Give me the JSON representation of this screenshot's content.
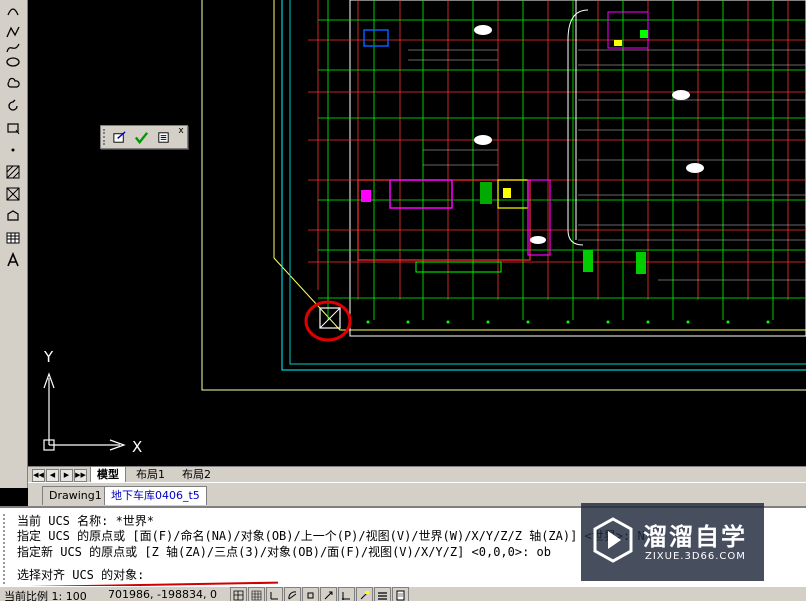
{
  "layout_tabs": {
    "nav_first": "◀◀",
    "nav_prev": "◀",
    "nav_next": "▶",
    "nav_last": "▶▶",
    "items": [
      "模型",
      "布局1",
      "布局2"
    ]
  },
  "document_tabs": [
    "Drawing1",
    "地下车库0406_t5"
  ],
  "command_line": {
    "line1": "当前 UCS 名称:  *世界*",
    "line2": "指定 UCS 的原点或 [面(F)/命名(NA)/对象(OB)/上一个(P)/视图(V)/世界(W)/X/Y/Z/Z 轴(ZA)] <世界>: N",
    "line3": "指定新 UCS 的原点或 [Z 轴(ZA)/三点(3)/对象(OB)/面(F)/视图(V)/X/Y/Z] <0,0,0>: ob",
    "prompt": "选择对齐 UCS 的对象:"
  },
  "status_bar": {
    "scale": "当前比例 1: 100",
    "coords": "701986,  -198834, 0"
  },
  "ucs_icon": {
    "x_label": "X",
    "y_label": "Y"
  },
  "float_toolbar": {
    "close": "x"
  },
  "watermark": {
    "title": "溜溜自学",
    "url": "ZIXUE.3D66.COM"
  },
  "icons": {
    "left_toolbar": [
      "arc-icon",
      "polyline-icon",
      "spline-icon",
      "ellipse-icon",
      "revision-cloud-icon",
      "rotate-icon",
      "block-icon",
      "point-icon",
      "hatch-icon",
      "gradient-icon",
      "region-icon",
      "table-icon",
      "text-icon"
    ]
  },
  "colors": {
    "canvas_bg": "#000000",
    "ui_gray": "#d4d0c8",
    "highlight_red": "#d00000",
    "cad_green": "#00ff00",
    "cad_red": "#ff0000",
    "cad_white": "#ffffff",
    "cad_yellow": "#ffff00",
    "cad_magenta": "#ff00ff",
    "cad_cyan": "#00ffff"
  }
}
